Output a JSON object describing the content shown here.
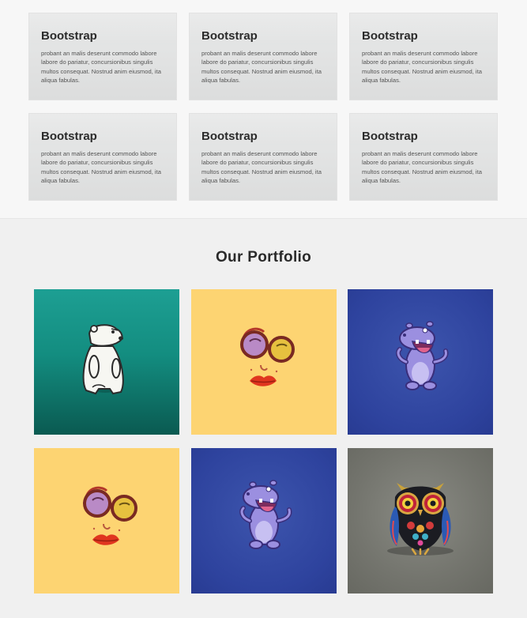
{
  "features": {
    "cards": [
      {
        "title": "Bootstrap",
        "text": "probant an malis deserunt commodo labore labore do pariatur, concursionibus singulis multos consequat. Nostrud anim eiusmod, ita aliqua fabulas."
      },
      {
        "title": "Bootstrap",
        "text": "probant an malis deserunt commodo labore labore do pariatur, concursionibus singulis multos consequat. Nostrud anim eiusmod, ita aliqua fabulas."
      },
      {
        "title": "Bootstrap",
        "text": "probant an malis deserunt commodo labore labore do pariatur, concursionibus singulis multos consequat. Nostrud anim eiusmod, ita aliqua fabulas."
      },
      {
        "title": "Bootstrap",
        "text": "probant an malis deserunt commodo labore labore do pariatur, concursionibus singulis multos consequat. Nostrud anim eiusmod, ita aliqua fabulas."
      },
      {
        "title": "Bootstrap",
        "text": "probant an malis deserunt commodo labore labore do pariatur, concursionibus singulis multos consequat. Nostrud anim eiusmod, ita aliqua fabulas."
      },
      {
        "title": "Bootstrap",
        "text": "probant an malis deserunt commodo labore labore do pariatur, concursionibus singulis multos consequat. Nostrud anim eiusmod, ita aliqua fabulas."
      }
    ]
  },
  "portfolio": {
    "title": "Our Portfolio",
    "items": [
      {
        "icon": "polar-bear-illustration",
        "background": "#138d80"
      },
      {
        "icon": "glasses-and-lips-illustration",
        "background": "#fdd472"
      },
      {
        "icon": "hippo-illustration",
        "background": "#2e439e"
      },
      {
        "icon": "glasses-and-lips-illustration",
        "background": "#fdd472"
      },
      {
        "icon": "hippo-illustration",
        "background": "#2e439e"
      },
      {
        "icon": "owl-illustration",
        "background": "#74756e"
      }
    ]
  }
}
